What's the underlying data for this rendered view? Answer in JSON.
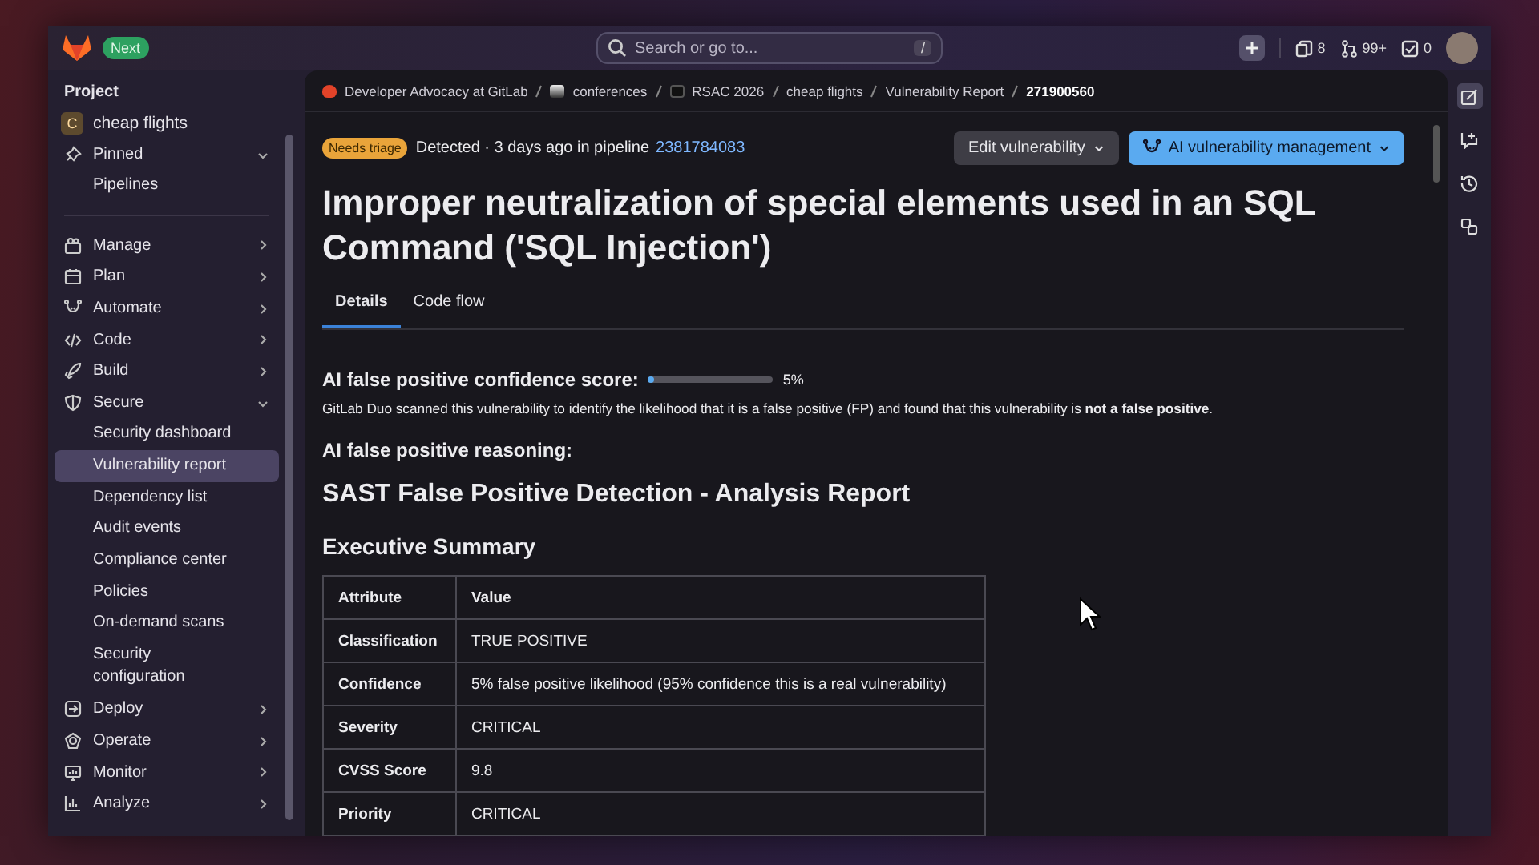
{
  "topbar": {
    "badge": "Next",
    "search": {
      "placeholder": "Search or go to...",
      "shortcut": "/"
    },
    "counters": [
      {
        "kind": "issues",
        "count": "8"
      },
      {
        "kind": "merge",
        "count": "99+"
      },
      {
        "kind": "todo",
        "count": "0"
      }
    ]
  },
  "sidebar": {
    "heading": "Project",
    "project": {
      "initial": "C",
      "name": "cheap flights"
    },
    "items": [
      {
        "label": "Pinned",
        "expanded": true,
        "selected": false,
        "children": [
          {
            "label": "Pipelines",
            "selected": false
          }
        ]
      },
      {
        "label": "Manage",
        "expanded": false,
        "selected": false
      },
      {
        "label": "Plan",
        "expanded": false,
        "selected": false
      },
      {
        "label": "Automate",
        "expanded": false,
        "selected": false
      },
      {
        "label": "Code",
        "expanded": false,
        "selected": false
      },
      {
        "label": "Build",
        "expanded": false,
        "selected": false
      },
      {
        "label": "Secure",
        "expanded": true,
        "selected": false,
        "children": [
          {
            "label": "Security dashboard",
            "selected": false
          },
          {
            "label": "Vulnerability report",
            "selected": true
          },
          {
            "label": "Dependency list",
            "selected": false
          },
          {
            "label": "Audit events",
            "selected": false
          },
          {
            "label": "Compliance center",
            "selected": false
          },
          {
            "label": "Policies",
            "selected": false
          },
          {
            "label": "On-demand scans",
            "selected": false
          },
          {
            "label": "Security configuration",
            "selected": false
          }
        ]
      },
      {
        "label": "Deploy",
        "expanded": false,
        "selected": false
      },
      {
        "label": "Operate",
        "expanded": false,
        "selected": false
      },
      {
        "label": "Monitor",
        "expanded": false,
        "selected": false
      },
      {
        "label": "Analyze",
        "expanded": false,
        "selected": false
      }
    ]
  },
  "breadcrumbs": [
    "Developer Advocacy at GitLab",
    "conferences",
    "RSAC 2026",
    "cheap flights",
    "Vulnerability Report",
    "271900560"
  ],
  "header": {
    "status": "Needs triage",
    "detected": "Detected · 3 days ago in pipeline",
    "pipeline": "2381784083",
    "buttons": [
      {
        "label": "Edit vulnerability",
        "kind": "secondary"
      },
      {
        "label": "AI vulnerability management",
        "kind": "primary"
      }
    ]
  },
  "title": "Improper neutralization of special elements used in an SQL Command ('SQL Injection')",
  "tabs": [
    {
      "label": "Details",
      "selected": true
    },
    {
      "label": "Code flow",
      "selected": false
    }
  ],
  "score": {
    "label": "AI false positive confidence score:",
    "level": 0.05,
    "reading": "5%",
    "description": "GitLab Duo scanned this vulnerability to identify the likelihood that it is a false positive (FP) and found that this vulnerability is **not a false positive**."
  },
  "reasoning_label": "AI false positive reasoning:",
  "report_title": "SAST False Positive Detection - Analysis Report",
  "summary_title": "Executive Summary",
  "table": {
    "columns": [
      "Attribute",
      "Value"
    ],
    "rows": [
      [
        "Classification",
        "TRUE POSITIVE"
      ],
      [
        "Confidence",
        "5% false positive likelihood (95% confidence this is a real vulnerability)"
      ],
      [
        "Severity",
        "CRITICAL"
      ],
      [
        "CVSS Score",
        "9.8"
      ],
      [
        "Priority",
        "CRITICAL"
      ]
    ]
  }
}
